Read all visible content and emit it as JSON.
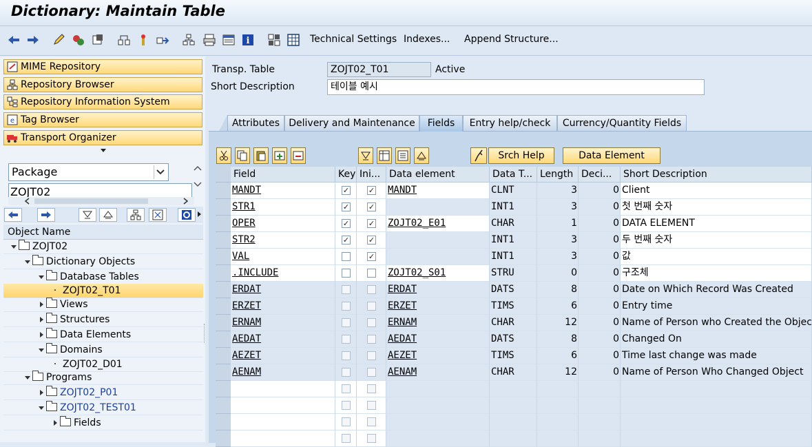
{
  "title": "Dictionary: Maintain Table",
  "toolbar": {
    "icons": [
      "back-arrow-icon",
      "forward-arrow-icon",
      "edit-pencil-icon",
      "display-change-icon",
      "activate-icon",
      "where-used-icon",
      "insert-icon",
      "navigate-icon",
      "hierarchy-icon",
      "print-icon",
      "display-object-list-icon",
      "info-icon",
      "tree-icon",
      "table-icon"
    ],
    "technical_settings": "Technical Settings",
    "indexes": "Indexes...",
    "append_structure": "Append Structure..."
  },
  "left": {
    "buttons": [
      "MIME Repository",
      "Repository Browser",
      "Repository Information System",
      "Tag Browser",
      "Transport Organizer"
    ],
    "combo_value": "Package",
    "package_input": "ZOJT02",
    "object_name_header": "Object Name",
    "tree": [
      {
        "label": "ZOJT02",
        "level": 0,
        "expand": "down",
        "folder": true
      },
      {
        "label": "Dictionary Objects",
        "level": 1,
        "expand": "down",
        "folder": true
      },
      {
        "label": "Database Tables",
        "level": 2,
        "expand": "down",
        "folder": true
      },
      {
        "label": "ZOJT02_T01",
        "level": 3,
        "expand": "dot",
        "folder": false,
        "selected": true
      },
      {
        "label": "Views",
        "level": 2,
        "expand": "right",
        "folder": true
      },
      {
        "label": "Structures",
        "level": 2,
        "expand": "right",
        "folder": true
      },
      {
        "label": "Data Elements",
        "level": 2,
        "expand": "right",
        "folder": true
      },
      {
        "label": "Domains",
        "level": 2,
        "expand": "down",
        "folder": true
      },
      {
        "label": "ZOJT02_D01",
        "level": 3,
        "expand": "dot",
        "folder": false
      },
      {
        "label": "Programs",
        "level": 1,
        "expand": "down",
        "folder": true
      },
      {
        "label": "ZOJT02_P01",
        "level": 2,
        "expand": "right",
        "folder": true,
        "blue": true
      },
      {
        "label": "ZOJT02_TEST01",
        "level": 2,
        "expand": "down",
        "folder": true,
        "blue": true
      },
      {
        "label": "Fields",
        "level": 3,
        "expand": "right",
        "folder": true
      }
    ]
  },
  "header": {
    "transp_table_label": "Transp. Table",
    "transp_table_value": "ZOJT02_T01",
    "status": "Active",
    "short_desc_label": "Short Description",
    "short_desc_value": "테이블 예시"
  },
  "tabs": [
    "Attributes",
    "Delivery and Maintenance",
    "Fields",
    "Entry help/check",
    "Currency/Quantity Fields"
  ],
  "grid_toolbar": {
    "srch_help": "Srch Help",
    "data_element": "Data Element"
  },
  "columns": [
    "Field",
    "Key",
    "Ini...",
    "Data element",
    "Data T...",
    "Length",
    "Deci...",
    "Short Description"
  ],
  "rows": [
    {
      "field": "MANDT",
      "key": true,
      "ini": true,
      "de": "MANDT",
      "dt": "CLNT",
      "len": "3",
      "dec": "0",
      "desc": "Client"
    },
    {
      "field": "STR1",
      "key": true,
      "ini": true,
      "de": "",
      "dt": "INT1",
      "len": "3",
      "dec": "0",
      "desc": "첫 번째 숫자"
    },
    {
      "field": "OPER",
      "key": true,
      "ini": true,
      "de": "ZOJT02_E01",
      "dt": "CHAR",
      "len": "1",
      "dec": "0",
      "desc": "DATA ELEMENT"
    },
    {
      "field": "STR2",
      "key": true,
      "ini": true,
      "de": "",
      "dt": "INT1",
      "len": "3",
      "dec": "0",
      "desc": "두 번째 숫자"
    },
    {
      "field": "VAL",
      "key": false,
      "ini": true,
      "de": "",
      "dt": "INT1",
      "len": "3",
      "dec": "0",
      "desc": "값"
    },
    {
      "field": ".INCLUDE",
      "key": false,
      "ini": false,
      "de": "ZOJT02_S01",
      "dt": "STRU",
      "len": "0",
      "dec": "0",
      "desc": "구조체"
    },
    {
      "field": "ERDAT",
      "key": false,
      "ini": false,
      "de": "ERDAT",
      "dt": "DATS",
      "len": "8",
      "dec": "0",
      "desc": "Date on Which Record Was Created"
    },
    {
      "field": "ERZET",
      "key": false,
      "ini": false,
      "de": "ERZET",
      "dt": "TIMS",
      "len": "6",
      "dec": "0",
      "desc": "Entry time"
    },
    {
      "field": "ERNAM",
      "key": false,
      "ini": false,
      "de": "ERNAM",
      "dt": "CHAR",
      "len": "12",
      "dec": "0",
      "desc": "Name of Person who Created the Object"
    },
    {
      "field": "AEDAT",
      "key": false,
      "ini": false,
      "de": "AEDAT",
      "dt": "DATS",
      "len": "8",
      "dec": "0",
      "desc": "Changed On"
    },
    {
      "field": "AEZET",
      "key": false,
      "ini": false,
      "de": "AEZET",
      "dt": "TIMS",
      "len": "6",
      "dec": "0",
      "desc": "Time last change was made"
    },
    {
      "field": "AENAM",
      "key": false,
      "ini": false,
      "de": "AENAM",
      "dt": "CHAR",
      "len": "12",
      "dec": "0",
      "desc": "Name of Person Who Changed Object"
    },
    {
      "field": "",
      "key": false,
      "ini": false,
      "de": "",
      "dt": "",
      "len": "",
      "dec": "",
      "desc": ""
    },
    {
      "field": "",
      "key": false,
      "ini": false,
      "de": "",
      "dt": "",
      "len": "",
      "dec": "",
      "desc": ""
    },
    {
      "field": "",
      "key": false,
      "ini": false,
      "de": "",
      "dt": "",
      "len": "",
      "dec": "",
      "desc": ""
    },
    {
      "field": "",
      "key": false,
      "ini": false,
      "de": "",
      "dt": "",
      "len": "",
      "dec": "",
      "desc": ""
    }
  ]
}
